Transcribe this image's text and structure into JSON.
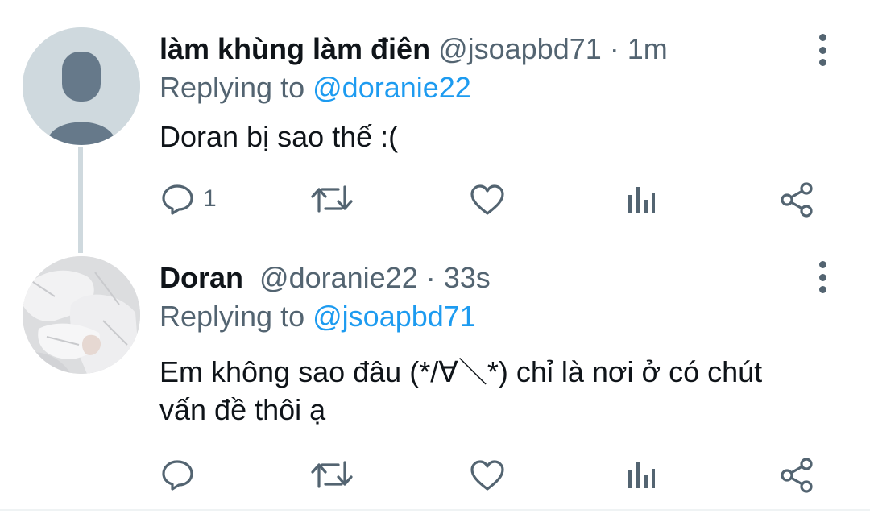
{
  "tweets": [
    {
      "display_name": "làm khùng làm điên",
      "handle": "@jsoapbd71",
      "time": "· 1m",
      "replying_prefix": "Replying to",
      "replying_to": "@doranie22",
      "text": "Doran bị sao thế :(",
      "reply_count": "1"
    },
    {
      "display_name": "Doran",
      "handle": "@doranie22",
      "time": "· 33s",
      "replying_prefix": "Replying to",
      "replying_to": "@jsoapbd71",
      "text_line1": "Em không sao đâu (*/∀＼*) chỉ là nơi ở có chút",
      "text_line2": "vấn đề thôi ạ",
      "reply_count": ""
    }
  ],
  "icons": [
    "more-vertical-icon",
    "reply-icon",
    "retweet-icon",
    "like-icon",
    "analytics-icon",
    "share-icon"
  ],
  "colors": {
    "link": "#1d9bf0",
    "muted": "#536471",
    "text": "#0f1419",
    "thread_line": "#cfd9de"
  }
}
